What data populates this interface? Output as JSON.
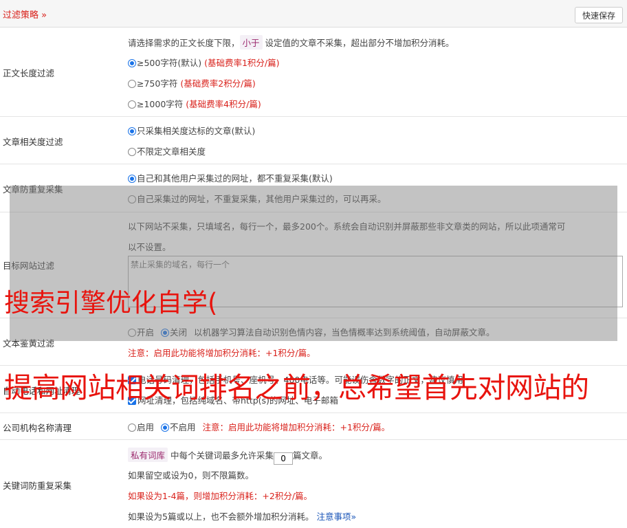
{
  "header": {
    "title": "过滤策略 »",
    "save_label": "快速保存"
  },
  "length_filter": {
    "label": "正文长度过滤",
    "desc_pre": "请选择需求的正文长度下限，",
    "desc_tag": "小于",
    "desc_post": "设定值的文章不采集，超出部分不增加积分消耗。",
    "options": [
      {
        "text": "≥500字符(默认)",
        "note": "(基础费率1积分/篇)"
      },
      {
        "text": "≥750字符",
        "note": "(基础费率2积分/篇)"
      },
      {
        "text": "≥1000字符",
        "note": "(基础费率4积分/篇)"
      }
    ]
  },
  "relevance": {
    "label": "文章相关度过滤",
    "opt1": "只采集相关度达标的文章(默认)",
    "opt2": "不限定文章相关度"
  },
  "dup": {
    "label": "文章防重复采集",
    "opt1": "自己和其他用户采集过的网址，都不重复采集(默认)",
    "opt2": "自己采集过的网址，不重复采集，其他用户采集过的，可以再采。"
  },
  "site": {
    "label": "目标网站过滤",
    "desc1": "以下网站不采集，只填域名，每行一个，最多200个。系统会自动识别并屏蔽那些非文章类的网站，所以此项通常可",
    "desc2": "以不设置。",
    "placeholder": "禁止采集的域名，每行一个"
  },
  "porn": {
    "label": "文本鉴黄过滤",
    "on": "开启",
    "off": "关闭",
    "desc": "以机器学习算法自动识别色情内容，当色情概率达到系统阈值，自动屏蔽文章。",
    "note": "注意：启用此功能将增加积分消耗：+1积分/篇。"
  },
  "contact": {
    "label": "自动电话和网址清理",
    "opt1": "电话号码清理，包括手机号、座机号、400电话等。可能误伤含数字的正文，建议慎用",
    "opt2": "网址清理，包括纯域名、带http(s)的网址、电子邮箱"
  },
  "org": {
    "label": "公司机构名称清理",
    "on": "启用",
    "off": "不启用",
    "note": "注意：启用此功能将增加积分消耗：+1积分/篇。"
  },
  "keyword": {
    "label": "关键词防重复采集",
    "tag": "私有词库",
    "pre": "中每个关键词最多允许采集",
    "value": "0",
    "post": "篇文章。",
    "line2": "如果留空或设为0，则不限篇数。",
    "line3": "如果设为1-4篇，则增加积分消耗：+2积分/篇。",
    "line4": "如果设为5篇或以上，也不会额外增加积分消耗。",
    "link": "注意事项»"
  },
  "watermarks": {
    "line1": "搜索引擎优化自学(",
    "line2": "提高网站相关词排名之前，总希望首先对网站的"
  }
}
